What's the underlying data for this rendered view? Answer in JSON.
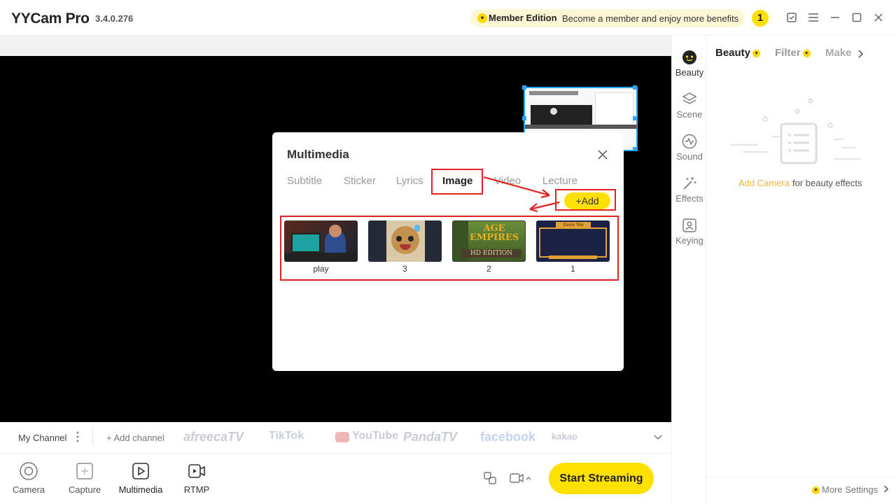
{
  "app": {
    "title": "YYCam Pro",
    "version": "3.4.0.276"
  },
  "member": {
    "edition": "Member Edition",
    "promo": "Become a member and enjoy more benefits",
    "notification_count": "1"
  },
  "modal": {
    "title": "Multimedia",
    "tabs": [
      {
        "label": "Subtitle"
      },
      {
        "label": "Sticker"
      },
      {
        "label": "Lyrics"
      },
      {
        "label": "Image"
      },
      {
        "label": "Video"
      },
      {
        "label": "Lecture"
      }
    ],
    "active_tab": "Image",
    "add_label": "+Add",
    "images": [
      {
        "caption": "play"
      },
      {
        "caption": "3"
      },
      {
        "caption": "2"
      },
      {
        "caption": "1"
      }
    ],
    "thumb_text": {
      "age": "AGE",
      "empires": "EMPIRES",
      "hd": "HD EDITION",
      "banner": "Game Title"
    }
  },
  "channels": {
    "my_channel": "My Channel",
    "add_channel": "+ Add channel",
    "platforms": [
      "afreecaTV",
      "TikTok",
      "YouTube",
      "PandaTV",
      "facebook",
      "kakao"
    ]
  },
  "bottom_nav": [
    {
      "label": "Camera"
    },
    {
      "label": "Capture"
    },
    {
      "label": "Multimedia"
    },
    {
      "label": "RTMP"
    }
  ],
  "start_streaming": "Start Streaming",
  "side_rail": [
    {
      "label": "Beauty"
    },
    {
      "label": "Scene"
    },
    {
      "label": "Sound"
    },
    {
      "label": "Effects"
    },
    {
      "label": "Keying"
    }
  ],
  "right_panel": {
    "tabs": [
      {
        "label": "Beauty"
      },
      {
        "label": "Filter"
      },
      {
        "label": "Make"
      }
    ],
    "add_camera_link": "Add Camera",
    "hint": "for beauty effects",
    "more_settings": "More Settings"
  },
  "colors": {
    "accent": "#ffe000",
    "highlight_red": "#e32222",
    "selection_blue": "#29a7ff"
  }
}
